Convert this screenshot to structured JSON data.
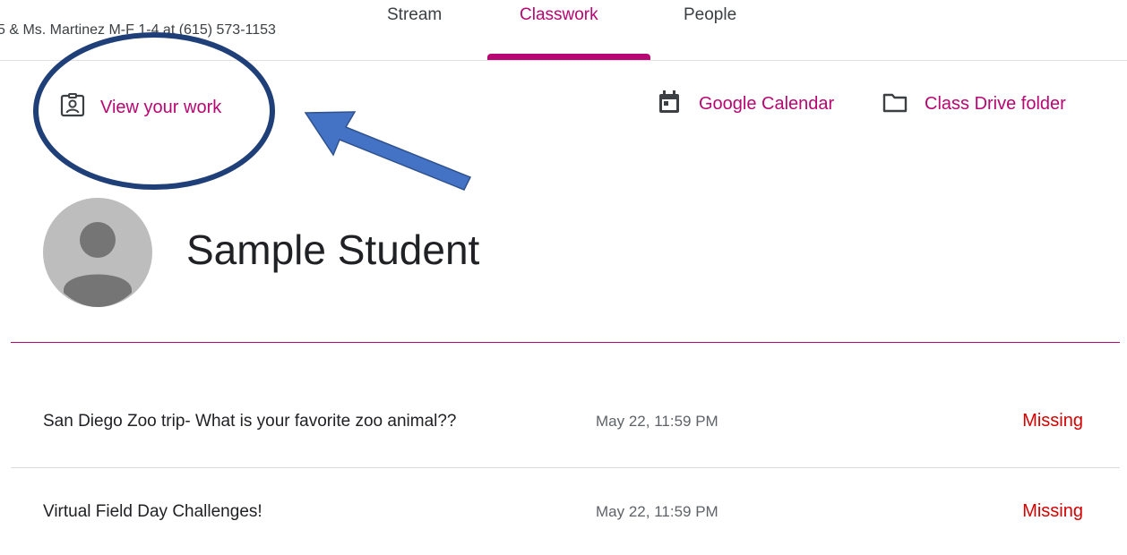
{
  "header": {
    "class_subtitle": "5 & Ms. Martinez M-F 1-4 at (615) 573-1153",
    "tabs": [
      {
        "label": "Stream"
      },
      {
        "label": "Classwork"
      },
      {
        "label": "People"
      }
    ],
    "active_tab": "Classwork"
  },
  "actions": {
    "view_work_label": "View your work",
    "calendar_label": "Google Calendar",
    "drive_label": "Class Drive folder"
  },
  "student": {
    "name": "Sample Student"
  },
  "assignments": [
    {
      "title": "San Diego Zoo trip- What is your favorite zoo animal??",
      "due": "May 22, 11:59 PM",
      "status": "Missing"
    },
    {
      "title": "Virtual Field Day Challenges!",
      "due": "May 22, 11:59 PM",
      "status": "Missing"
    }
  ],
  "colors": {
    "accent": "#b80672",
    "missing": "#d50000",
    "annotation_circle": "#1f3f78",
    "annotation_arrow": "#4472c4"
  },
  "icons": {
    "view_work": "assignment-ind-icon",
    "calendar": "calendar-icon",
    "drive": "folder-icon",
    "avatar": "person-icon"
  }
}
